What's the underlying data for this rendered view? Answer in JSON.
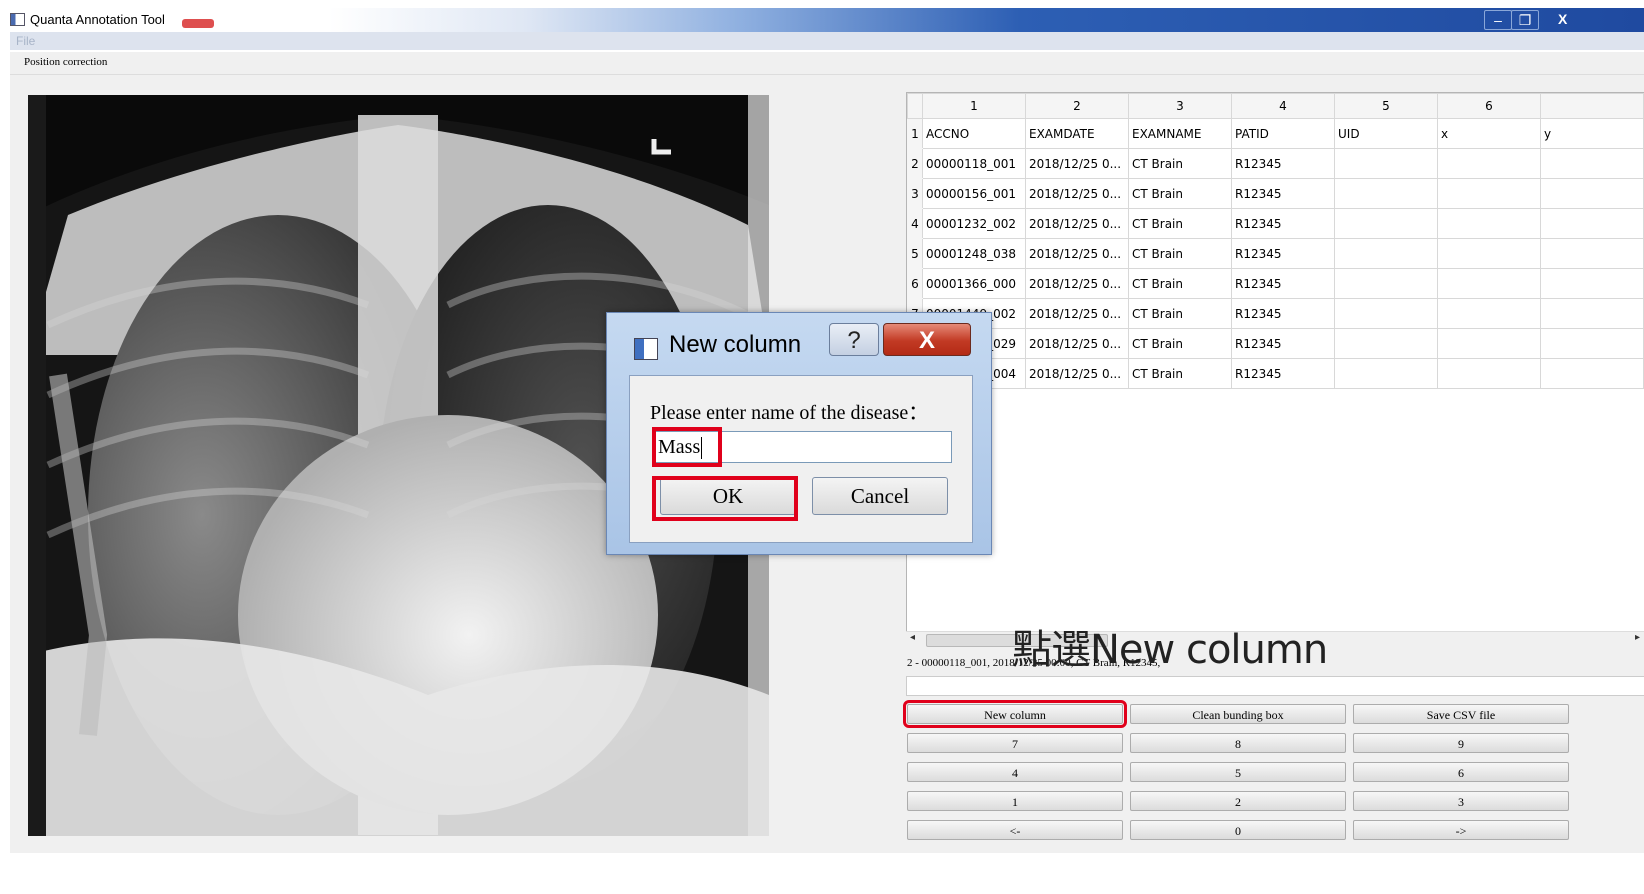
{
  "window": {
    "title": "Quanta Annotation Tool",
    "minimize": "–",
    "restore": "❐",
    "close": "X"
  },
  "menu": {
    "file": "File"
  },
  "toolbar": {
    "position_correction": "Position correction"
  },
  "table": {
    "columns": [
      "1",
      "2",
      "3",
      "4",
      "5",
      "6"
    ],
    "rows": [
      [
        "1",
        "ACCNO",
        "EXAMDATE",
        "EXAMNAME",
        "PATID",
        "UID",
        "x",
        "y"
      ],
      [
        "2",
        "00000118_001",
        "2018/12/25 0...",
        "CT Brain",
        "R12345",
        "",
        "",
        ""
      ],
      [
        "3",
        "00000156_001",
        "2018/12/25 0...",
        "CT Brain",
        "R12345",
        "",
        "",
        ""
      ],
      [
        "4",
        "00001232_002",
        "2018/12/25 0...",
        "CT Brain",
        "R12345",
        "",
        "",
        ""
      ],
      [
        "5",
        "00001248_038",
        "2018/12/25 0...",
        "CT Brain",
        "R12345",
        "",
        "",
        ""
      ],
      [
        "6",
        "00001366_000",
        "2018/12/25 0...",
        "CT Brain",
        "R12345",
        "",
        "",
        ""
      ],
      [
        "7",
        "00001449_002",
        "2018/12/25 0...",
        "CT Brain",
        "R12345",
        "",
        "",
        ""
      ],
      [
        "8",
        "00001612_029",
        "2018/12/25 0...",
        "CT Brain",
        "R12345",
        "",
        "",
        ""
      ],
      [
        "9",
        "00001688_004",
        "2018/12/25 0...",
        "CT Brain",
        "R12345",
        "",
        "",
        ""
      ]
    ]
  },
  "status_line": "2 - 00000118_001, 2018/12/25 00:00, CT Brain, R12345,",
  "annotation_caption": "點選New column",
  "buttons": {
    "new_column": "New column",
    "clean_bbox": "Clean bunding box",
    "save_csv": "Save CSV file",
    "k7": "7",
    "k8": "8",
    "k9": "9",
    "k4": "4",
    "k5": "5",
    "k6": "6",
    "k1": "1",
    "k2": "2",
    "k3": "3",
    "prev": "<-",
    "k0": "0",
    "next": "->"
  },
  "dialog": {
    "title": "New column",
    "help": "?",
    "close": "X",
    "prompt": "Please enter name of the disease：",
    "input_value": "Mass",
    "ok": "OK",
    "cancel": "Cancel"
  },
  "colors": {
    "highlight": "#e0001b",
    "titlebar_blue": "#1f4aa0"
  }
}
